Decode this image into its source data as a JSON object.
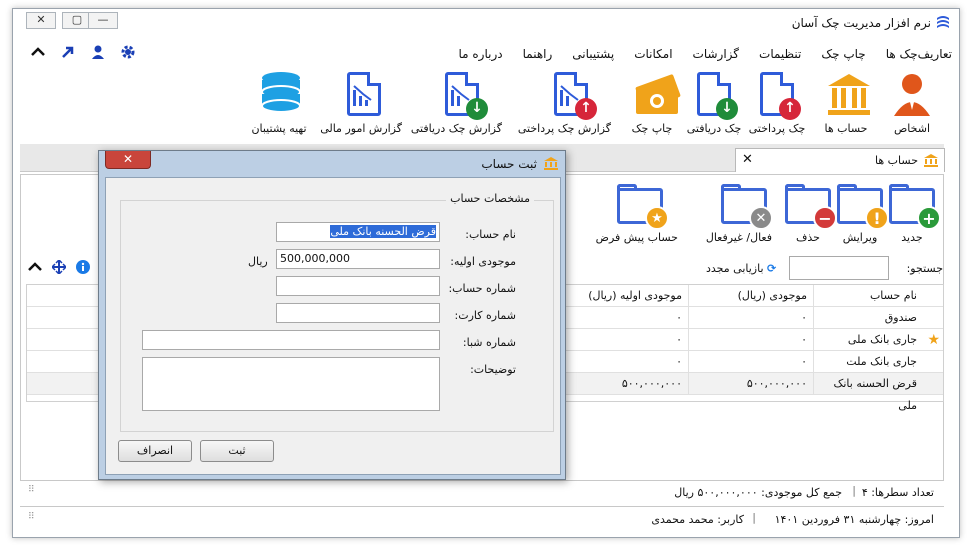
{
  "window": {
    "title": "نرم افزار مدیریت چک آسان",
    "controls": {
      "close": "✕",
      "restore": "▢",
      "minimize": "—"
    }
  },
  "menu": [
    "تعاریف",
    "چک ها",
    "چاپ چک",
    "تنظیمات",
    "گزارشات",
    "امکانات",
    "پشتیبانی",
    "راهنما",
    "درباره ما"
  ],
  "ribbon": [
    {
      "label": "اشخاص"
    },
    {
      "label": "حساب ها"
    },
    {
      "label": "چک پرداختی"
    },
    {
      "label": "چک دریافتی"
    },
    {
      "label": "چاپ چک"
    },
    {
      "label": "گزارش چک پرداختی"
    },
    {
      "label": "گزارش چک دریافتی"
    },
    {
      "label": "گزارش امور مالی"
    },
    {
      "label": "تهیه پشتیبان"
    }
  ],
  "tab": {
    "title": "حساب ها",
    "close": "✕"
  },
  "actions": [
    {
      "label": "جدید",
      "badge": "+",
      "color": "#2a9a3a"
    },
    {
      "label": "ویرایش",
      "badge": "!",
      "color": "#f0a31a"
    },
    {
      "label": "حذف",
      "badge": "−",
      "color": "#d33a3a"
    },
    {
      "label": "فعال/ غیرفعال",
      "badge": "✕",
      "color": "#8a8a8a"
    },
    {
      "label": "حساب پیش فرض",
      "badge": "★",
      "color": "#f0a31a"
    }
  ],
  "search": {
    "label": "جستجو:",
    "refresh": "بازیابی مجدد",
    "value": ""
  },
  "grid": {
    "columns": [
      "نام حساب",
      "موجودی (ریال)",
      "موجودی اولیه (ریال)"
    ],
    "rows": [
      {
        "name": "صندوق",
        "balance": "۰",
        "initial": "۰",
        "star": false
      },
      {
        "name": "جاری بانک ملی",
        "balance": "۰",
        "initial": "۰",
        "star": true
      },
      {
        "name": "جاری بانک ملت",
        "balance": "۰",
        "initial": "۰",
        "star": false
      },
      {
        "name": "قرض الحسنه بانک ملی",
        "balance": "۵۰۰,۰۰۰,۰۰۰",
        "initial": "۵۰۰,۰۰۰,۰۰۰",
        "star": false
      }
    ]
  },
  "status": {
    "rowcount": "تعداد سطرها:  ۴",
    "total": "جمع کل موجودی: ۵۰۰,۰۰۰,۰۰۰ ریال",
    "today": "امروز: چهارشنبه ۳۱ فروردین ۱۴۰۱",
    "user": "کاربر: محمد محمدی"
  },
  "dialog": {
    "title": "ثبت حساب",
    "close": "✕",
    "group": "مشخصات حساب",
    "fields": {
      "name_label": "نام حساب:",
      "name_value": "قرض الحسنه بانک ملی",
      "initial_label": "موجودی اولیه:",
      "initial_value": "500,000,000",
      "currency": "ریال",
      "account_label": "شماره حساب:",
      "card_label": "شماره کارت:",
      "sheba_label": "شماره شبا:",
      "desc_label": "توضیحات:"
    },
    "ok": "ثبت",
    "cancel": "انصراف"
  }
}
